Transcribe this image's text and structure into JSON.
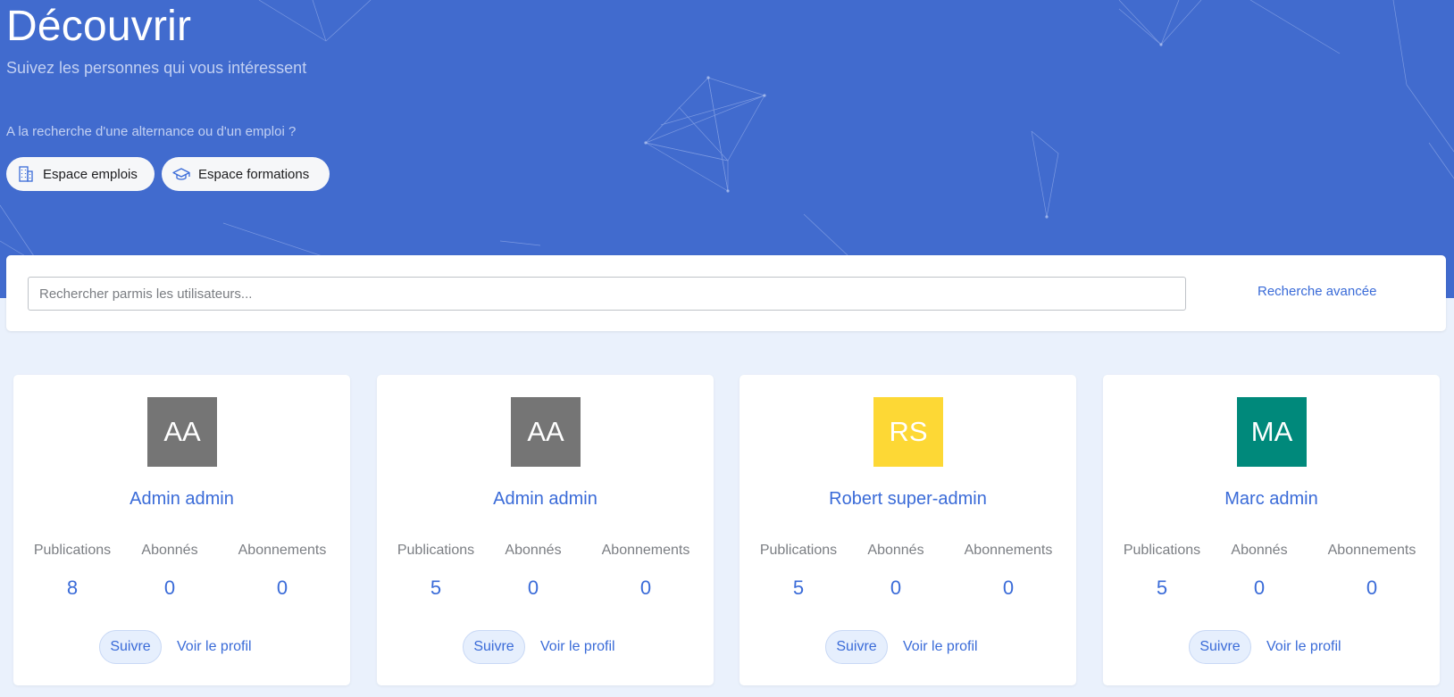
{
  "header": {
    "title": "Découvrir",
    "subtitle": "Suivez les personnes qui vous intéressent",
    "question": "A la recherche d'une alternance ou d'un emploi ?",
    "buttons": [
      {
        "label": "Espace emplois",
        "icon": "building-icon"
      },
      {
        "label": "Espace formations",
        "icon": "graduation-cap-icon"
      }
    ],
    "colors": {
      "banner": "#416bce",
      "accent": "#3a6bd8"
    }
  },
  "search": {
    "placeholder": "Rechercher parmis les utilisateurs...",
    "value": "",
    "advanced_label": "Recherche avancée"
  },
  "stat_labels": {
    "publications": "Publications",
    "abonnes": "Abonnés",
    "abonnements": "Abonnements"
  },
  "actions": {
    "follow": "Suivre",
    "view_profile": "Voir le profil"
  },
  "users": [
    {
      "initials": "AA",
      "avatar_color": "#757575",
      "name": "Admin admin",
      "publications": "8",
      "abonnes": "0",
      "abonnements": "0"
    },
    {
      "initials": "AA",
      "avatar_color": "#757575",
      "name": "Admin admin",
      "publications": "5",
      "abonnes": "0",
      "abonnements": "0"
    },
    {
      "initials": "RS",
      "avatar_color": "#fdd835",
      "name": "Robert super-admin",
      "publications": "5",
      "abonnes": "0",
      "abonnements": "0"
    },
    {
      "initials": "MA",
      "avatar_color": "#00897b",
      "name": "Marc admin",
      "publications": "5",
      "abonnes": "0",
      "abonnements": "0"
    }
  ]
}
